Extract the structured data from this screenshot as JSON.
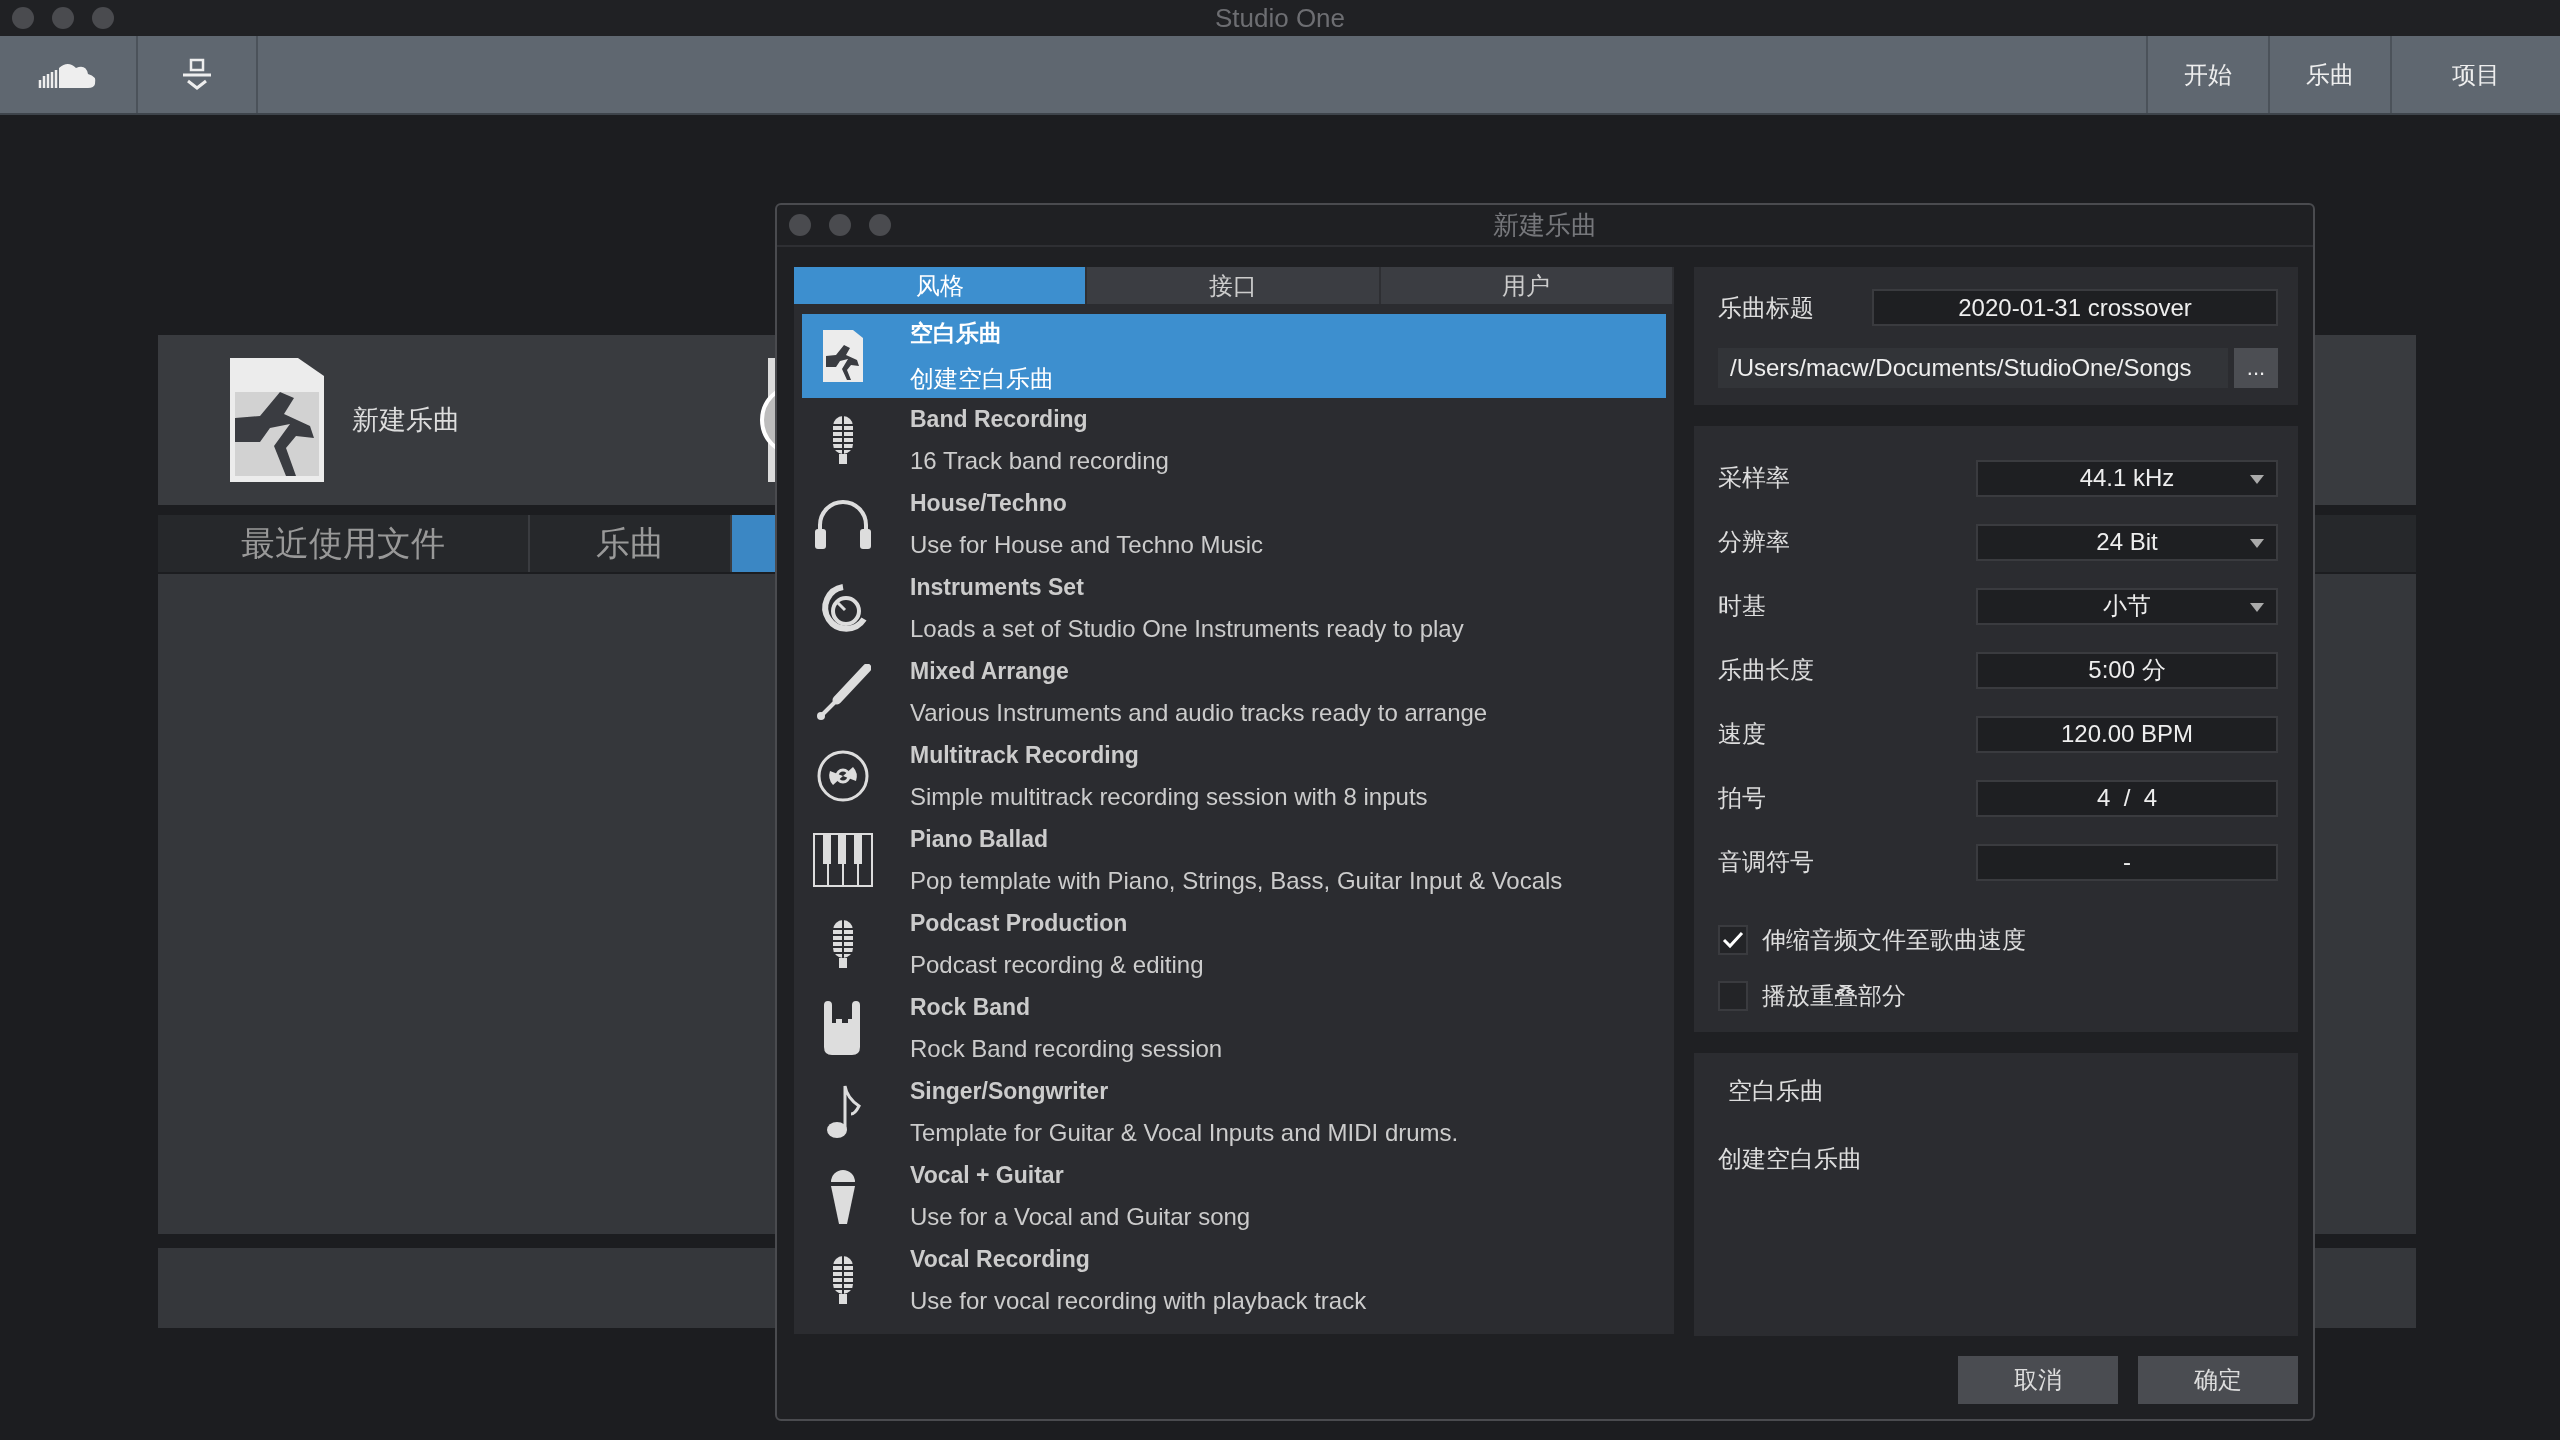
{
  "window": {
    "title": "Studio One"
  },
  "toolbar": {
    "nav": [
      "开始",
      "乐曲",
      "项目"
    ]
  },
  "start_page": {
    "new_song_label": "新建乐曲",
    "tabs": [
      {
        "label": "最近使用文件",
        "selected": false
      },
      {
        "label": "乐曲",
        "selected": false
      },
      {
        "selected": true
      }
    ]
  },
  "dialog": {
    "title": "新建乐曲",
    "tabs": [
      {
        "label": "风格",
        "selected": true
      },
      {
        "label": "接口",
        "selected": false
      },
      {
        "label": "用户",
        "selected": false
      }
    ],
    "templates": [
      {
        "kind": "document",
        "title": "空白乐曲",
        "description": "创建空白乐曲",
        "selected": true
      },
      {
        "kind": "microphone",
        "title": "Band Recording",
        "description": "16 Track band recording",
        "selected": false
      },
      {
        "kind": "headphones",
        "title": "House/Techno",
        "description": "Use for House and Techno Music",
        "selected": false
      },
      {
        "kind": "knob",
        "title": "Instruments Set",
        "description": "Loads a set of Studio One Instruments ready to play",
        "selected": false
      },
      {
        "kind": "cable",
        "title": "Mixed Arrange",
        "description": "Various Instruments and audio tracks ready to arrange",
        "selected": false
      },
      {
        "kind": "disc",
        "title": "Multitrack Recording",
        "description": "Simple multitrack recording session with 8 inputs",
        "selected": false
      },
      {
        "kind": "piano",
        "title": "Piano Ballad",
        "description": "Pop template with Piano, Strings, Bass, Guitar Input & Vocals",
        "selected": false
      },
      {
        "kind": "microphone",
        "title": "Podcast Production",
        "description": "Podcast recording & editing",
        "selected": false
      },
      {
        "kind": "hand",
        "title": "Rock Band",
        "description": "Rock Band recording session",
        "selected": false
      },
      {
        "kind": "note",
        "title": "Singer/Songwriter",
        "description": "Template for Guitar & Vocal Inputs and MIDI drums.",
        "selected": false
      },
      {
        "kind": "handmic",
        "title": "Vocal + Guitar",
        "description": "Use for a Vocal and Guitar song",
        "selected": false
      },
      {
        "kind": "microphone",
        "title": "Vocal Recording",
        "description": "Use for vocal recording with playback track",
        "selected": false
      }
    ],
    "song_title_label": "乐曲标题",
    "song_title": "2020-01-31 crossover",
    "path": "/Users/macw/Documents/StudioOne/Songs",
    "browse_button": "...",
    "settings": [
      {
        "kind": "dropdown",
        "label": "采样率",
        "value": "44.1 kHz"
      },
      {
        "kind": "dropdown",
        "label": "分辨率",
        "value": "24 Bit"
      },
      {
        "kind": "dropdown",
        "label": "时基",
        "value": "小节"
      },
      {
        "kind": "field",
        "label": "乐曲长度",
        "value": "5:00 分"
      },
      {
        "kind": "field",
        "label": "速度",
        "value": "120.00 BPM"
      },
      {
        "kind": "field",
        "label": "拍号",
        "value": "4  /  4"
      },
      {
        "kind": "field",
        "label": "音调符号",
        "value": "-"
      }
    ],
    "options": [
      {
        "label": "伸缩音频文件至歌曲速度",
        "checked": true
      },
      {
        "label": "播放重叠部分",
        "checked": false
      }
    ],
    "summary": {
      "title": "空白乐曲",
      "text": "创建空白乐曲"
    },
    "buttons": [
      "取消",
      "确定"
    ]
  }
}
